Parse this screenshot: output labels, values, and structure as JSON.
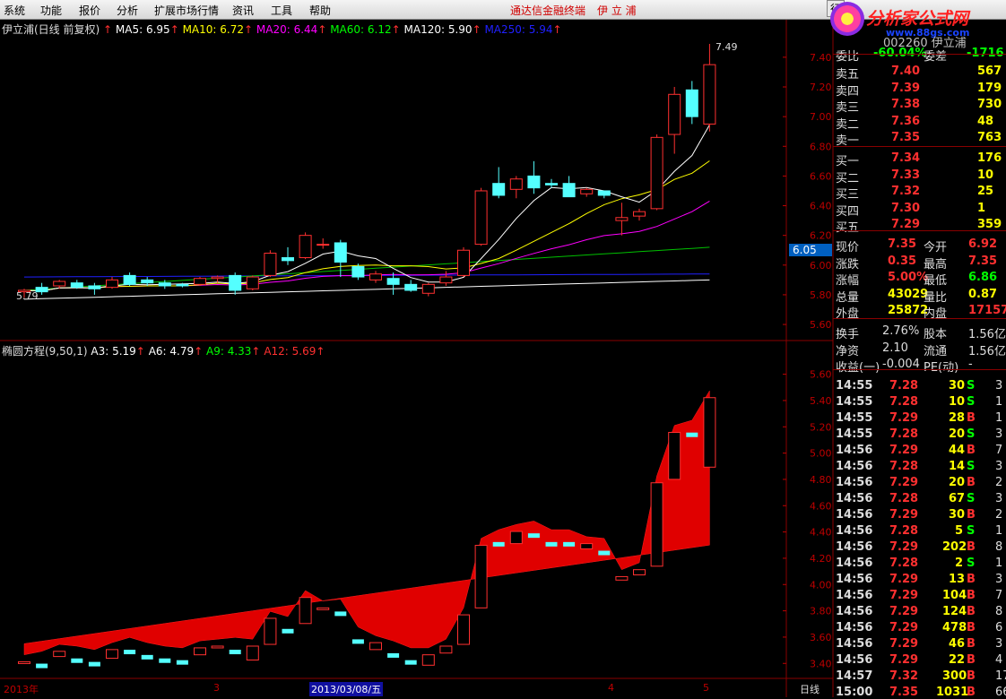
{
  "menu": {
    "items": [
      "系统",
      "功能",
      "报价",
      "分析",
      "扩展市场行情",
      "资讯",
      "工具",
      "帮助"
    ],
    "title_text": "通达信金融终端",
    "stock_title": "伊 立 浦",
    "corner_button": "行"
  },
  "logo": {
    "name": "分析家公式网",
    "url": "www.88gs.com"
  },
  "main_chart": {
    "title": "伊立浦(日线 前复权)",
    "ma": [
      {
        "label": "MA5: 6.95",
        "color": "#ffffff"
      },
      {
        "label": "MA10: 6.72",
        "color": "#ffff00"
      },
      {
        "label": "MA20: 6.44",
        "color": "#ff00ff"
      },
      {
        "label": "MA60: 6.12",
        "color": "#00ff00"
      },
      {
        "label": "MA120: 5.90",
        "color": "#ffffff"
      },
      {
        "label": "MA250: 5.94",
        "color": "#2020ff"
      }
    ],
    "high_label": "7.49",
    "low_label": "5.79",
    "current_price_tag": "6.05",
    "y_ticks": [
      "7.40",
      "7.20",
      "7.00",
      "6.80",
      "6.60",
      "6.40",
      "6.20",
      "6.00",
      "5.80",
      "5.60"
    ]
  },
  "sub_chart": {
    "title": "椭圆方程(9,50,1)",
    "lines": [
      {
        "label": "A3: 5.19",
        "color": "#ffffff"
      },
      {
        "label": "A6: 4.79",
        "color": "#ffffff"
      },
      {
        "label": "A9: 4.33",
        "color": "#00ff00"
      },
      {
        "label": "A12: 5.69",
        "color": "#ff0000"
      }
    ],
    "y_ticks": [
      "5.60",
      "5.40",
      "5.20",
      "5.00",
      "4.80",
      "4.60",
      "4.40",
      "4.20",
      "4.00",
      "3.80",
      "3.60",
      "3.40"
    ]
  },
  "x_axis": {
    "labels": [
      "2013年",
      "3",
      "2013/03/08/五",
      "4",
      "5"
    ],
    "period": "日线"
  },
  "chart_data": {
    "type": "candlestick",
    "candles": [
      [
        5.82,
        5.84,
        5.78,
        5.83
      ],
      [
        5.85,
        5.88,
        5.8,
        5.82
      ],
      [
        5.86,
        5.9,
        5.84,
        5.89
      ],
      [
        5.88,
        5.9,
        5.84,
        5.85
      ],
      [
        5.86,
        5.88,
        5.8,
        5.84
      ],
      [
        5.85,
        5.92,
        5.84,
        5.9
      ],
      [
        5.93,
        5.95,
        5.86,
        5.87
      ],
      [
        5.9,
        5.92,
        5.86,
        5.88
      ],
      [
        5.88,
        5.9,
        5.84,
        5.86
      ],
      [
        5.87,
        5.88,
        5.85,
        5.86
      ],
      [
        5.87,
        5.92,
        5.86,
        5.91
      ],
      [
        5.91,
        5.93,
        5.88,
        5.92
      ],
      [
        5.93,
        5.95,
        5.8,
        5.83
      ],
      [
        5.84,
        5.93,
        5.83,
        5.92
      ],
      [
        5.93,
        6.1,
        5.92,
        6.08
      ],
      [
        6.05,
        6.12,
        6.0,
        6.03
      ],
      [
        6.05,
        6.22,
        6.04,
        6.2
      ],
      [
        6.14,
        6.18,
        6.11,
        6.14
      ],
      [
        6.15,
        6.17,
        5.92,
        6.02
      ],
      [
        5.99,
        6.01,
        5.9,
        5.92
      ],
      [
        5.9,
        5.96,
        5.88,
        5.94
      ],
      [
        5.91,
        5.95,
        5.8,
        5.87
      ],
      [
        5.87,
        5.9,
        5.82,
        5.83
      ],
      [
        5.81,
        5.88,
        5.79,
        5.87
      ],
      [
        5.88,
        5.96,
        5.86,
        5.92
      ],
      [
        5.93,
        6.12,
        5.92,
        6.1
      ],
      [
        6.14,
        6.52,
        6.13,
        6.5
      ],
      [
        6.55,
        6.66,
        6.45,
        6.47
      ],
      [
        6.51,
        6.6,
        6.45,
        6.58
      ],
      [
        6.6,
        6.7,
        6.48,
        6.52
      ],
      [
        6.55,
        6.58,
        6.52,
        6.54
      ],
      [
        6.55,
        6.6,
        6.47,
        6.46
      ],
      [
        6.48,
        6.52,
        6.46,
        6.51
      ],
      [
        6.5,
        6.5,
        6.45,
        6.47
      ],
      [
        6.3,
        6.42,
        6.2,
        6.32
      ],
      [
        6.33,
        6.38,
        6.3,
        6.36
      ],
      [
        6.38,
        6.88,
        6.37,
        6.86
      ],
      [
        6.88,
        7.2,
        6.75,
        7.15
      ],
      [
        7.18,
        7.24,
        6.95,
        7.0
      ],
      [
        6.95,
        7.49,
        6.9,
        7.35
      ]
    ],
    "ma5_end": 6.95,
    "ma10_end": 6.72,
    "ma20_end": 6.44,
    "ma60_end": 6.12,
    "ma120_end": 5.9,
    "ma250_end": 5.94,
    "indicator": {
      "A3": 5.19,
      "A6": 4.79,
      "A9": 4.33,
      "A12": 5.69
    }
  },
  "quote": {
    "code_line": "002260 伊立浦",
    "weibi": {
      "label": "委比",
      "value": "-60.04%",
      "label2": "委差",
      "value2": "-1716"
    },
    "sell": [
      {
        "label": "卖五",
        "price": "7.40",
        "vol": "567"
      },
      {
        "label": "卖四",
        "price": "7.39",
        "vol": "179"
      },
      {
        "label": "卖三",
        "price": "7.38",
        "vol": "730"
      },
      {
        "label": "卖二",
        "price": "7.36",
        "vol": "48"
      },
      {
        "label": "卖一",
        "price": "7.35",
        "vol": "763"
      }
    ],
    "buy": [
      {
        "label": "买一",
        "price": "7.34",
        "vol": "176"
      },
      {
        "label": "买二",
        "price": "7.33",
        "vol": "10"
      },
      {
        "label": "买三",
        "price": "7.32",
        "vol": "25"
      },
      {
        "label": "买四",
        "price": "7.30",
        "vol": "1"
      },
      {
        "label": "买五",
        "price": "7.29",
        "vol": "359"
      }
    ],
    "stats": [
      {
        "l1": "现价",
        "v1": "7.35",
        "l2": "今开",
        "v2": "6.92"
      },
      {
        "l1": "涨跌",
        "v1": "0.35",
        "l2": "最高",
        "v2": "7.35"
      },
      {
        "l1": "涨幅",
        "v1": "5.00%",
        "l2": "最低",
        "v2": "6.86"
      },
      {
        "l1": "总量",
        "v1": "43029",
        "l2": "量比",
        "v2": "0.87"
      },
      {
        "l1": "外盘",
        "v1": "25872",
        "l2": "内盘",
        "v2": "17157"
      }
    ],
    "stats2": [
      {
        "l1": "换手",
        "v1": "2.76%",
        "l2": "股本",
        "v2": "1.56亿"
      },
      {
        "l1": "净资",
        "v1": "2.10",
        "l2": "流通",
        "v2": "1.56亿"
      },
      {
        "l1": "收益(一)",
        "v1": "-0.004",
        "l2": "PE(动)",
        "v2": "-"
      }
    ],
    "ticks": [
      {
        "t": "14:55",
        "p": "7.28",
        "v": "30",
        "d": "S",
        "n": "3"
      },
      {
        "t": "14:55",
        "p": "7.28",
        "v": "10",
        "d": "S",
        "n": "1"
      },
      {
        "t": "14:55",
        "p": "7.29",
        "v": "28",
        "d": "B",
        "n": "1"
      },
      {
        "t": "14:55",
        "p": "7.28",
        "v": "20",
        "d": "S",
        "n": "3"
      },
      {
        "t": "14:56",
        "p": "7.29",
        "v": "44",
        "d": "B",
        "n": "7"
      },
      {
        "t": "14:56",
        "p": "7.28",
        "v": "14",
        "d": "S",
        "n": "3"
      },
      {
        "t": "14:56",
        "p": "7.29",
        "v": "20",
        "d": "B",
        "n": "2"
      },
      {
        "t": "14:56",
        "p": "7.28",
        "v": "67",
        "d": "S",
        "n": "3"
      },
      {
        "t": "14:56",
        "p": "7.29",
        "v": "30",
        "d": "B",
        "n": "2"
      },
      {
        "t": "14:56",
        "p": "7.28",
        "v": "5",
        "d": "S",
        "n": "1"
      },
      {
        "t": "14:56",
        "p": "7.29",
        "v": "202",
        "d": "B",
        "n": "8"
      },
      {
        "t": "14:56",
        "p": "7.28",
        "v": "2",
        "d": "S",
        "n": "1"
      },
      {
        "t": "14:56",
        "p": "7.29",
        "v": "13",
        "d": "B",
        "n": "3"
      },
      {
        "t": "14:56",
        "p": "7.29",
        "v": "104",
        "d": "B",
        "n": "7"
      },
      {
        "t": "14:56",
        "p": "7.29",
        "v": "124",
        "d": "B",
        "n": "8"
      },
      {
        "t": "14:56",
        "p": "7.29",
        "v": "478",
        "d": "B",
        "n": "6"
      },
      {
        "t": "14:56",
        "p": "7.29",
        "v": "46",
        "d": "B",
        "n": "3"
      },
      {
        "t": "14:56",
        "p": "7.29",
        "v": "22",
        "d": "B",
        "n": "4"
      },
      {
        "t": "14:57",
        "p": "7.32",
        "v": "300",
        "d": "B",
        "n": "17"
      },
      {
        "t": "15:00",
        "p": "7.35",
        "v": "1031",
        "d": "B",
        "n": "66"
      }
    ]
  }
}
